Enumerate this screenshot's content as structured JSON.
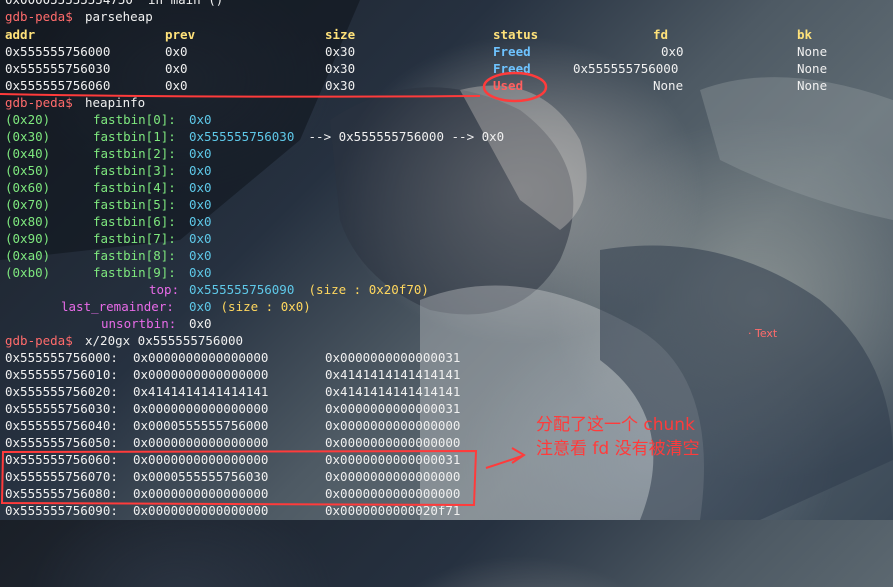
{
  "top_partial": "0x000055555554750  in main ()",
  "prompt_label": "gdb-peda$",
  "commands": {
    "parseheap": "parseheap",
    "heapinfo": "heapinfo",
    "x20gx": "x/20gx 0x555555756000"
  },
  "parseheap": {
    "headers": [
      "addr",
      "prev",
      "size",
      "status",
      "fd",
      "bk"
    ],
    "rows": [
      [
        "0x555555756000",
        "0x0",
        "0x30",
        "Freed",
        "0x0",
        "None"
      ],
      [
        "0x555555756030",
        "0x0",
        "0x30",
        "Freed",
        "0x555555756000",
        "None"
      ],
      [
        "0x555555756060",
        "0x0",
        "0x30",
        "Used",
        "None",
        "None"
      ]
    ]
  },
  "heapinfo": {
    "fastbins": [
      {
        "size": "(0x20)",
        "label": "fastbin[0]:",
        "value": "0x0"
      },
      {
        "size": "(0x30)",
        "label": "fastbin[1]:",
        "value": "0x555555756030",
        "chain": " --> 0x555555756000 --> 0x0"
      },
      {
        "size": "(0x40)",
        "label": "fastbin[2]:",
        "value": "0x0"
      },
      {
        "size": "(0x50)",
        "label": "fastbin[3]:",
        "value": "0x0"
      },
      {
        "size": "(0x60)",
        "label": "fastbin[4]:",
        "value": "0x0"
      },
      {
        "size": "(0x70)",
        "label": "fastbin[5]:",
        "value": "0x0"
      },
      {
        "size": "(0x80)",
        "label": "fastbin[6]:",
        "value": "0x0"
      },
      {
        "size": "(0x90)",
        "label": "fastbin[7]:",
        "value": "0x0"
      },
      {
        "size": "(0xa0)",
        "label": "fastbin[8]:",
        "value": "0x0"
      },
      {
        "size": "(0xb0)",
        "label": "fastbin[9]:",
        "value": "0x0"
      }
    ],
    "top": {
      "label": "top:",
      "value": "0x555555756090",
      "extra": " (size : 0x20f70)"
    },
    "last_remainder": {
      "label": "last_remainder:",
      "value": "0x0",
      "extra": " (size : 0x0)"
    },
    "unsortbin": {
      "label": "unsortbin:",
      "value": "0x0"
    }
  },
  "memdump": [
    {
      "addr": "0x555555756000:",
      "a": "0x0000000000000000",
      "b": "0x0000000000000031"
    },
    {
      "addr": "0x555555756010:",
      "a": "0x0000000000000000",
      "b": "0x4141414141414141"
    },
    {
      "addr": "0x555555756020:",
      "a": "0x4141414141414141",
      "b": "0x4141414141414141"
    },
    {
      "addr": "0x555555756030:",
      "a": "0x0000000000000000",
      "b": "0x0000000000000031"
    },
    {
      "addr": "0x555555756040:",
      "a": "0x0000555555756000",
      "b": "0x0000000000000000"
    },
    {
      "addr": "0x555555756050:",
      "a": "0x0000000000000000",
      "b": "0x0000000000000000"
    },
    {
      "addr": "0x555555756060:",
      "a": "0x0000000000000000",
      "b": "0x0000000000000031"
    },
    {
      "addr": "0x555555756070:",
      "a": "0x0000555555756030",
      "b": "0x0000000000000000"
    },
    {
      "addr": "0x555555756080:",
      "a": "0x0000000000000000",
      "b": "0x0000000000000000"
    },
    {
      "addr": "0x555555756090:",
      "a": "0x0000000000000000",
      "b": "0x0000000000020f71"
    }
  ],
  "annotation": {
    "line1": "分配了这一个 chunk",
    "line2": "注意看 fd 没有被清空",
    "side_tag": "· Text"
  },
  "colors": {
    "annotation": "#ff3b3b",
    "prompt": "#ff6b6b",
    "header": "#ffe27a",
    "freed": "#6ec3ff",
    "used": "#ff5f5f",
    "cyan": "#5ec8e8",
    "green": "#7ee87e",
    "yellow": "#ffd75e",
    "magenta": "#e86be8"
  }
}
